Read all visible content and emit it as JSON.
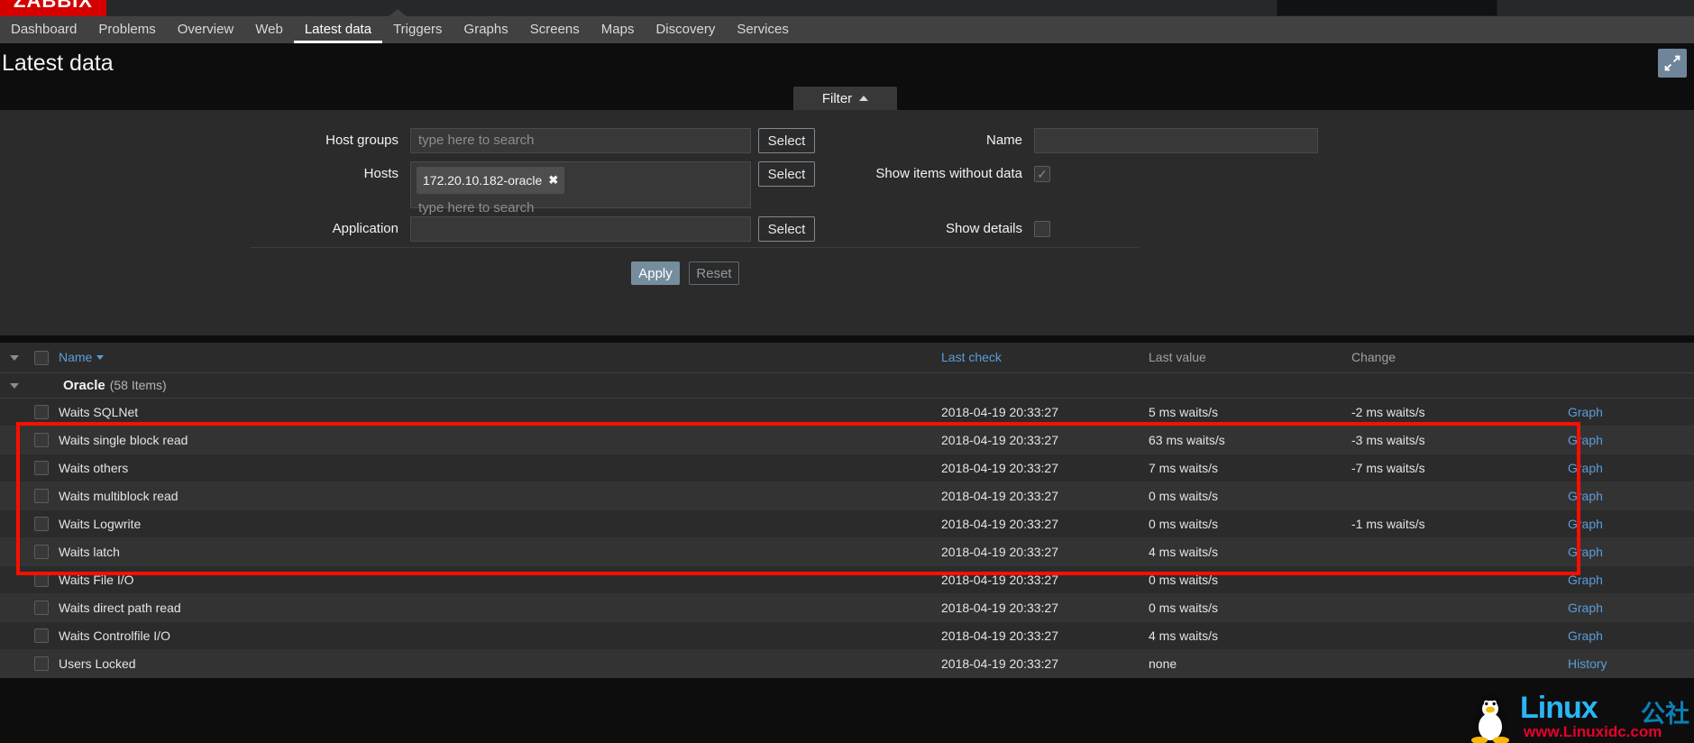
{
  "app": {
    "logo_text": "ZABBIX",
    "search_placeholder": ""
  },
  "nav": {
    "items": [
      {
        "label": "Dashboard",
        "active": false
      },
      {
        "label": "Problems",
        "active": false
      },
      {
        "label": "Overview",
        "active": false
      },
      {
        "label": "Web",
        "active": false
      },
      {
        "label": "Latest data",
        "active": true
      },
      {
        "label": "Triggers",
        "active": false
      },
      {
        "label": "Graphs",
        "active": false
      },
      {
        "label": "Screens",
        "active": false
      },
      {
        "label": "Maps",
        "active": false
      },
      {
        "label": "Discovery",
        "active": false
      },
      {
        "label": "Services",
        "active": false
      }
    ]
  },
  "header": {
    "title": "Latest data",
    "kiosk_icon": "expand-arrows-icon"
  },
  "filter": {
    "tab_label": "Filter",
    "tab_caret": "triangle-up-icon",
    "host_groups": {
      "label": "Host groups",
      "value": "",
      "placeholder": "type here to search",
      "select_label": "Select"
    },
    "hosts": {
      "label": "Hosts",
      "tokens": [
        "172.20.10.182-oracle"
      ],
      "placeholder": "type here to search",
      "select_label": "Select"
    },
    "application": {
      "label": "Application",
      "value": "",
      "placeholder": "",
      "select_label": "Select"
    },
    "name": {
      "label": "Name",
      "value": "",
      "placeholder": ""
    },
    "show_items_without_data": {
      "label": "Show items without data",
      "checked": true,
      "check_glyph": "✓"
    },
    "show_details": {
      "label": "Show details",
      "checked": false,
      "check_glyph": ""
    },
    "apply_label": "Apply",
    "reset_label": "Reset"
  },
  "table": {
    "columns": {
      "name": "Name",
      "last_check": "Last check",
      "last_value": "Last value",
      "change": "Change",
      "graph": ""
    },
    "group": {
      "name": "Oracle",
      "count": "(58 Items)"
    },
    "graph_label": "Graph",
    "history_label": "History",
    "rows": [
      {
        "name": "Waits SQLNet",
        "last_check": "2018-04-19 20:33:27",
        "last_value": "5 ms waits/s",
        "change": "-2 ms waits/s",
        "action": "Graph"
      },
      {
        "name": "Waits single block read",
        "last_check": "2018-04-19 20:33:27",
        "last_value": "63 ms waits/s",
        "change": "-3 ms waits/s",
        "action": "Graph"
      },
      {
        "name": "Waits others",
        "last_check": "2018-04-19 20:33:27",
        "last_value": "7 ms waits/s",
        "change": "-7 ms waits/s",
        "action": "Graph"
      },
      {
        "name": "Waits multiblock read",
        "last_check": "2018-04-19 20:33:27",
        "last_value": "0 ms waits/s",
        "change": "",
        "action": "Graph"
      },
      {
        "name": "Waits Logwrite",
        "last_check": "2018-04-19 20:33:27",
        "last_value": "0 ms waits/s",
        "change": "-1 ms waits/s",
        "action": "Graph"
      },
      {
        "name": "Waits latch",
        "last_check": "2018-04-19 20:33:27",
        "last_value": "4 ms waits/s",
        "change": "",
        "action": "Graph"
      },
      {
        "name": "Waits File I/O",
        "last_check": "2018-04-19 20:33:27",
        "last_value": "0 ms waits/s",
        "change": "",
        "action": "Graph"
      },
      {
        "name": "Waits direct path read",
        "last_check": "2018-04-19 20:33:27",
        "last_value": "0 ms waits/s",
        "change": "",
        "action": "Graph"
      },
      {
        "name": "Waits Controlfile I/O",
        "last_check": "2018-04-19 20:33:27",
        "last_value": "4 ms waits/s",
        "change": "",
        "action": "Graph"
      },
      {
        "name": "Users Locked",
        "last_check": "2018-04-19 20:33:27",
        "last_value": "none",
        "change": "",
        "action": "History"
      }
    ]
  },
  "watermark": {
    "brand": "Linux",
    "brand_cn": "公社",
    "url": "www.Linuxidc.com"
  },
  "colors": {
    "brand_red": "#d40000",
    "link_blue": "#5b9dd9",
    "accent_blue_grey": "#768d9e",
    "annotation_red": "#fa0f00"
  }
}
